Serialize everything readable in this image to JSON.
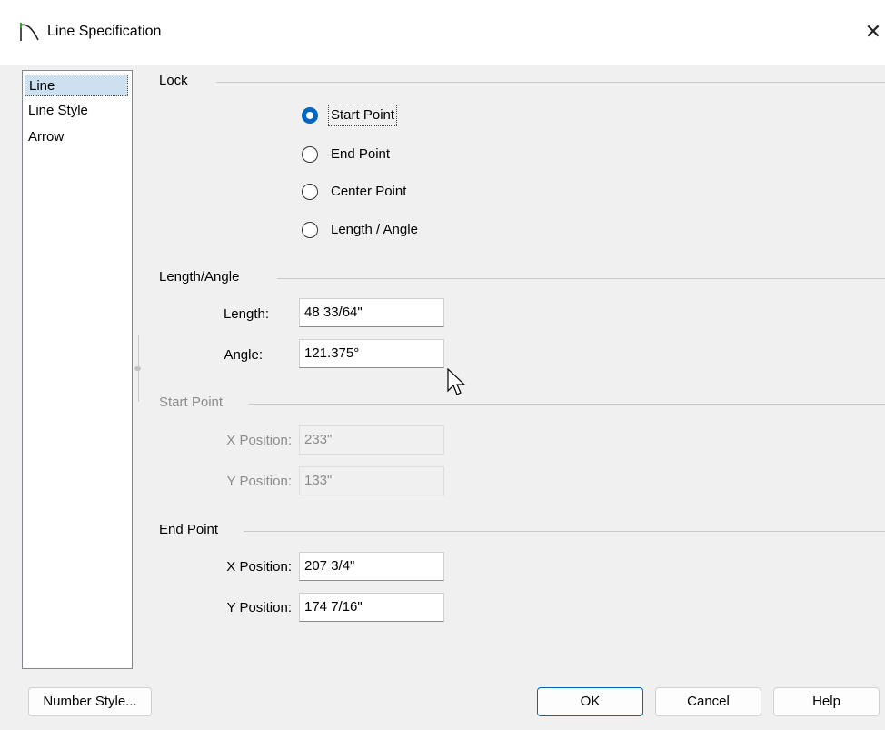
{
  "window": {
    "title": "Line Specification"
  },
  "sidebar": {
    "items": [
      "Line",
      "Line Style",
      "Arrow"
    ],
    "selected": "Line"
  },
  "lock": {
    "label": "Lock",
    "options": [
      "Start Point",
      "End Point",
      "Center Point",
      "Length / Angle"
    ],
    "selected": "Start Point"
  },
  "length_angle": {
    "label": "Length/Angle",
    "length_label": "Length:",
    "length_value": "48 33/64\"",
    "angle_label": "Angle:",
    "angle_value": "121.375°"
  },
  "start_point": {
    "label": "Start Point",
    "enabled": false,
    "x_label": "X Position:",
    "x_value": "233\"",
    "y_label": "Y Position:",
    "y_value": "133\""
  },
  "end_point": {
    "label": "End Point",
    "x_label": "X Position:",
    "x_value": "207 3/4\"",
    "y_label": "Y Position:",
    "y_value": "174 7/16\""
  },
  "buttons": {
    "number_style": "Number Style...",
    "ok": "OK",
    "cancel": "Cancel",
    "help": "Help"
  },
  "colors": {
    "accent": "#0067c0",
    "dialog_bg": "#f0f0f0",
    "disabled_text": "#8c8c8c"
  }
}
